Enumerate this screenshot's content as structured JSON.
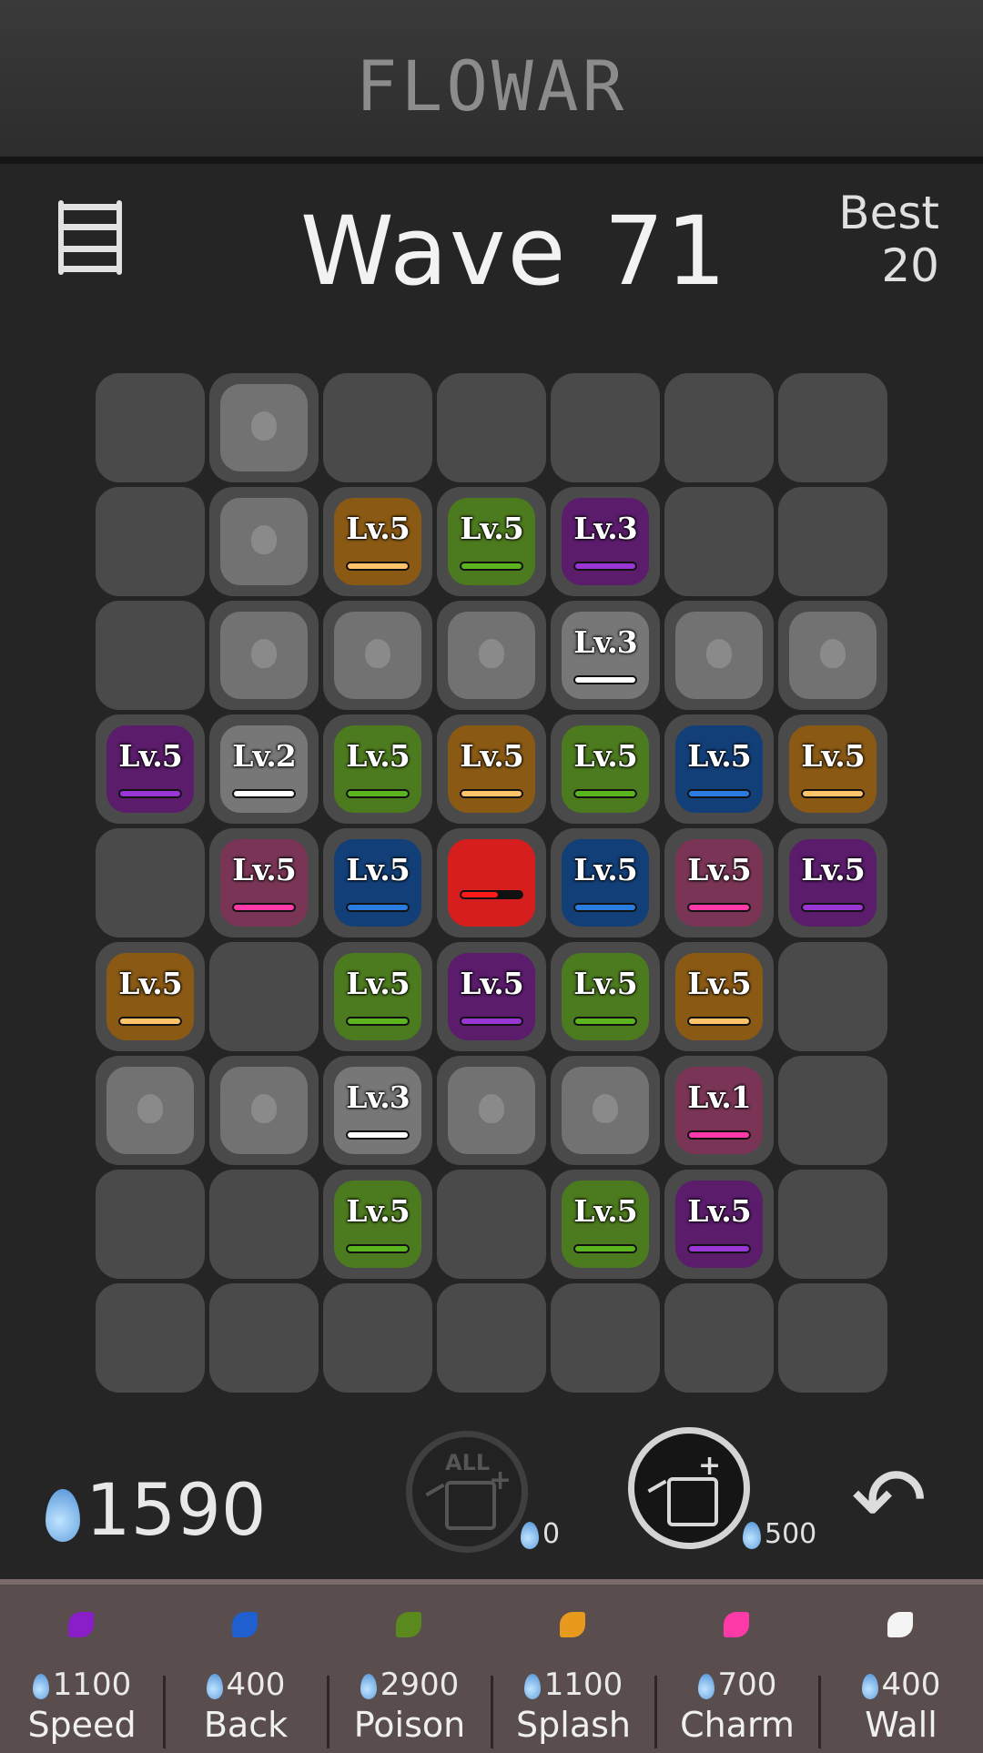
{
  "header": {
    "title": "FLOWAR"
  },
  "hud": {
    "wave_label": "Wave",
    "wave_number": "71",
    "best_label": "Best",
    "best_value": "20",
    "menu_icon": "menu-icon"
  },
  "board": {
    "cols": 7,
    "rows": 9,
    "colors": {
      "purple": "#5a1c6b",
      "white": "#777777",
      "green": "#4c7a1e",
      "orange": "#8a5a14",
      "blue": "#123f78",
      "pink": "#7a3556",
      "red": "#d61e1e"
    },
    "bar_colors": {
      "purple": "#9a35d6",
      "white": "#ffffff",
      "green": "#5bb51e",
      "orange": "#ffc46a",
      "blue": "#2a7de0",
      "pink": "#ff3aa8",
      "red": "#ff1a1a"
    },
    "tiles": [
      {
        "r": 0,
        "c": 1,
        "type": "empty"
      },
      {
        "r": 1,
        "c": 1,
        "type": "empty"
      },
      {
        "r": 1,
        "c": 2,
        "type": "flower",
        "color": "orange",
        "level": "Lv.5"
      },
      {
        "r": 1,
        "c": 3,
        "type": "flower",
        "color": "green",
        "level": "Lv.5"
      },
      {
        "r": 1,
        "c": 4,
        "type": "flower",
        "color": "purple",
        "level": "Lv.3"
      },
      {
        "r": 2,
        "c": 1,
        "type": "empty"
      },
      {
        "r": 2,
        "c": 2,
        "type": "empty"
      },
      {
        "r": 2,
        "c": 3,
        "type": "empty"
      },
      {
        "r": 2,
        "c": 4,
        "type": "flower",
        "color": "white",
        "level": "Lv.3"
      },
      {
        "r": 2,
        "c": 5,
        "type": "empty"
      },
      {
        "r": 2,
        "c": 6,
        "type": "empty"
      },
      {
        "r": 3,
        "c": 0,
        "type": "flower",
        "color": "purple",
        "level": "Lv.5"
      },
      {
        "r": 3,
        "c": 1,
        "type": "flower",
        "color": "white",
        "level": "Lv.2"
      },
      {
        "r": 3,
        "c": 2,
        "type": "flower",
        "color": "green",
        "level": "Lv.5"
      },
      {
        "r": 3,
        "c": 3,
        "type": "flower",
        "color": "orange",
        "level": "Lv.5"
      },
      {
        "r": 3,
        "c": 4,
        "type": "flower",
        "color": "green",
        "level": "Lv.5"
      },
      {
        "r": 3,
        "c": 5,
        "type": "flower",
        "color": "blue",
        "level": "Lv.5"
      },
      {
        "r": 3,
        "c": 6,
        "type": "flower",
        "color": "orange",
        "level": "Lv.5"
      },
      {
        "r": 4,
        "c": 1,
        "type": "flower",
        "color": "pink",
        "level": "Lv.5"
      },
      {
        "r": 4,
        "c": 2,
        "type": "flower",
        "color": "blue",
        "level": "Lv.5"
      },
      {
        "r": 4,
        "c": 3,
        "type": "core",
        "color": "red",
        "level": "",
        "health": 0.6
      },
      {
        "r": 4,
        "c": 4,
        "type": "flower",
        "color": "blue",
        "level": "Lv.5"
      },
      {
        "r": 4,
        "c": 5,
        "type": "flower",
        "color": "pink",
        "level": "Lv.5"
      },
      {
        "r": 4,
        "c": 6,
        "type": "flower",
        "color": "purple",
        "level": "Lv.5"
      },
      {
        "r": 5,
        "c": 0,
        "type": "flower",
        "color": "orange",
        "level": "Lv.5"
      },
      {
        "r": 5,
        "c": 2,
        "type": "flower",
        "color": "green",
        "level": "Lv.5"
      },
      {
        "r": 5,
        "c": 3,
        "type": "flower",
        "color": "purple",
        "level": "Lv.5"
      },
      {
        "r": 5,
        "c": 4,
        "type": "flower",
        "color": "green",
        "level": "Lv.5"
      },
      {
        "r": 5,
        "c": 5,
        "type": "flower",
        "color": "orange",
        "level": "Lv.5"
      },
      {
        "r": 6,
        "c": 0,
        "type": "empty"
      },
      {
        "r": 6,
        "c": 1,
        "type": "empty"
      },
      {
        "r": 6,
        "c": 2,
        "type": "flower",
        "color": "white",
        "level": "Lv.3"
      },
      {
        "r": 6,
        "c": 3,
        "type": "empty"
      },
      {
        "r": 6,
        "c": 4,
        "type": "empty"
      },
      {
        "r": 6,
        "c": 5,
        "type": "flower",
        "color": "pink",
        "level": "Lv.1"
      },
      {
        "r": 7,
        "c": 2,
        "type": "flower",
        "color": "green",
        "level": "Lv.5"
      },
      {
        "r": 7,
        "c": 4,
        "type": "flower",
        "color": "green",
        "level": "Lv.5"
      },
      {
        "r": 7,
        "c": 5,
        "type": "flower",
        "color": "purple",
        "level": "Lv.5"
      }
    ]
  },
  "resources": {
    "drops": "1590",
    "drop_icon": "water-drop-icon"
  },
  "actions": {
    "water_all": {
      "label": "ALL",
      "cost": "0",
      "icon": "watering-can-all-icon"
    },
    "water_one": {
      "cost": "500",
      "icon": "watering-can-icon"
    },
    "undo": {
      "icon": "undo-arrow-icon"
    }
  },
  "shop": [
    {
      "price": "1100",
      "name": "Speed",
      "color": "#8a1fc9"
    },
    {
      "price": "400",
      "name": "Back",
      "color": "#1f5fd0"
    },
    {
      "price": "2900",
      "name": "Poison",
      "color": "#5a8a1e"
    },
    {
      "price": "1100",
      "name": "Splash",
      "color": "#e89a1e"
    },
    {
      "price": "700",
      "name": "Charm",
      "color": "#ff3aa8"
    },
    {
      "price": "400",
      "name": "Wall",
      "color": "#f4f4f4"
    }
  ]
}
